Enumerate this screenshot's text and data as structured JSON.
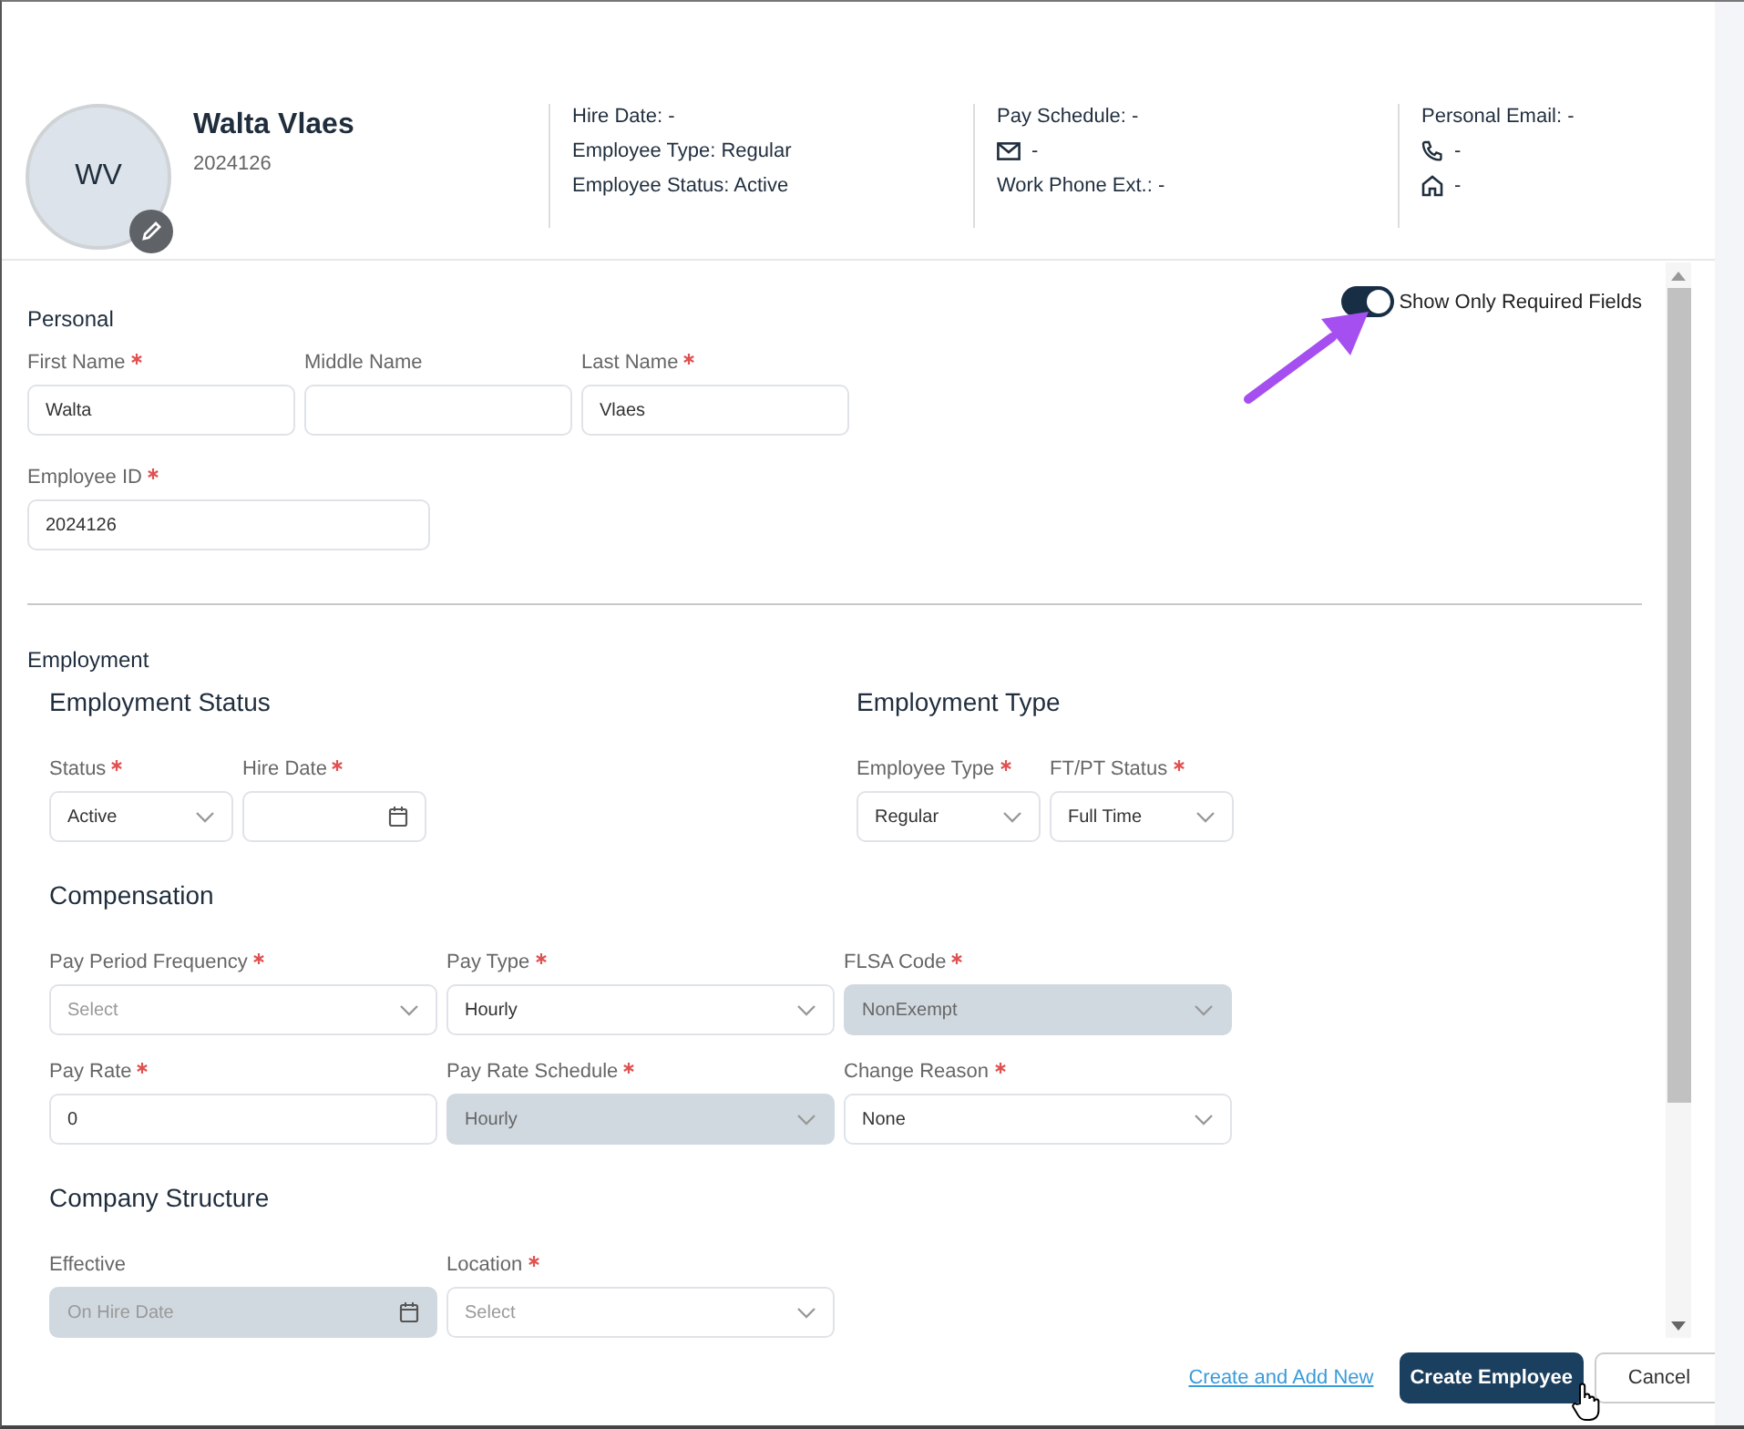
{
  "header": {
    "initials": "WV",
    "name": "Walta Vlaes",
    "employee_id": "2024126",
    "info_columns": [
      [
        {
          "kind": "text",
          "text": "Hire Date: -"
        },
        {
          "kind": "text",
          "text": "Employee Type: Regular"
        },
        {
          "kind": "text",
          "text": "Employee Status: Active"
        }
      ],
      [
        {
          "kind": "text",
          "text": "Pay Schedule: -"
        },
        {
          "kind": "email",
          "text": "-"
        },
        {
          "kind": "text",
          "text": "Work Phone Ext.: -"
        }
      ],
      [
        {
          "kind": "text",
          "text": "Personal Email: -"
        },
        {
          "kind": "phone",
          "text": "-"
        },
        {
          "kind": "home",
          "text": "-"
        }
      ]
    ]
  },
  "required_toggle": {
    "label": "Show Only Required Fields",
    "on": true
  },
  "sections": [
    {
      "title": "Personal",
      "group_rows": [
        [
          {
            "rows": [
              [
                {
                  "label": "First Name",
                  "required": true,
                  "kind": "text",
                  "value": "Walta",
                  "disabled": false
                },
                {
                  "label": "Middle Name",
                  "required": false,
                  "kind": "text",
                  "disabled": false
                },
                {
                  "label": "Last Name",
                  "required": true,
                  "kind": "text",
                  "value": "Vlaes",
                  "disabled": false
                }
              ],
              [
                {
                  "label": "Employee ID",
                  "required": true,
                  "kind": "text",
                  "value": "2024126",
                  "disabled": false
                }
              ]
            ]
          }
        ]
      ]
    },
    {
      "title": "Employment",
      "group_rows": [
        [
          {
            "title": "Employment Status",
            "rows": [
              [
                {
                  "label": "Status",
                  "required": true,
                  "kind": "select",
                  "value": "Active",
                  "disabled": false
                },
                {
                  "label": "Hire Date",
                  "required": true,
                  "kind": "date",
                  "disabled": false
                }
              ]
            ]
          },
          {
            "title": "Employment Type",
            "rows": [
              [
                {
                  "label": "Employee Type",
                  "required": true,
                  "kind": "select",
                  "value": "Regular",
                  "disabled": false
                },
                {
                  "label": "FT/PT Status",
                  "required": true,
                  "kind": "select",
                  "value": "Full Time",
                  "disabled": false
                }
              ]
            ]
          }
        ],
        [
          {
            "title": "Compensation",
            "rows": [
              [
                {
                  "label": "Pay Period Frequency",
                  "required": true,
                  "kind": "select",
                  "placeholder": "Select",
                  "disabled": false
                },
                {
                  "label": "Pay Type",
                  "required": true,
                  "kind": "select",
                  "value": "Hourly",
                  "disabled": false
                },
                {
                  "label": "FLSA Code",
                  "required": true,
                  "kind": "select",
                  "value": "NonExempt",
                  "disabled": true
                }
              ],
              [
                {
                  "label": "Pay Rate",
                  "required": true,
                  "kind": "text",
                  "value": "0",
                  "disabled": false
                },
                {
                  "label": "Pay Rate Schedule",
                  "required": true,
                  "kind": "select",
                  "value": "Hourly",
                  "disabled": true
                },
                {
                  "label": "Change Reason",
                  "required": true,
                  "kind": "select",
                  "value": "None",
                  "disabled": false
                }
              ]
            ]
          }
        ],
        [
          {
            "title": "Company Structure",
            "rows": [
              [
                {
                  "label": "Effective",
                  "required": false,
                  "kind": "date",
                  "placeholder": "On Hire Date",
                  "disabled": true
                },
                {
                  "label": "Location",
                  "required": true,
                  "kind": "select",
                  "placeholder": "Select",
                  "disabled": false
                }
              ]
            ]
          }
        ]
      ]
    }
  ],
  "footer": {
    "buttons": [
      {
        "kind": "link",
        "label": "Create and Add New"
      },
      {
        "kind": "primary",
        "label": "Create Employee"
      },
      {
        "kind": "secondary",
        "label": "Cancel"
      }
    ]
  }
}
